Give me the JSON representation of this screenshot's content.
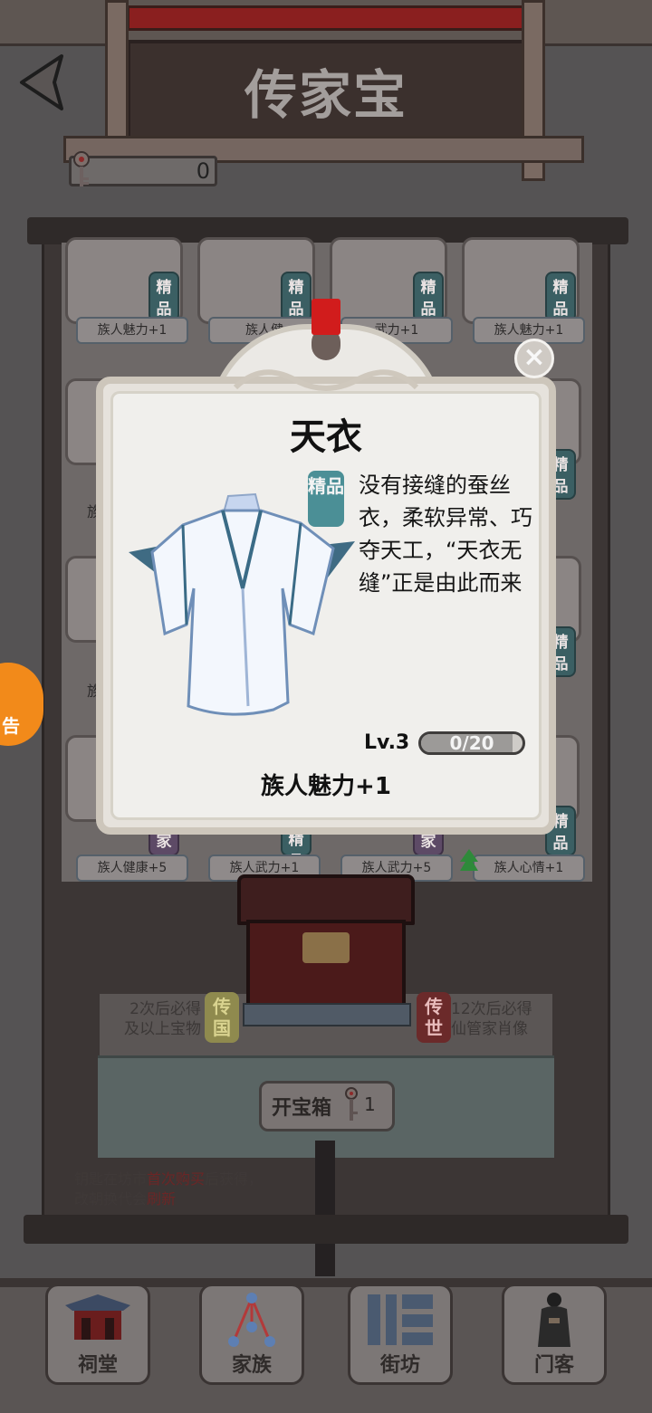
{
  "header": {
    "title": "传家宝",
    "key_count": "0"
  },
  "grid": {
    "top_row": [
      {
        "label": "族人魅力+1",
        "tag": "精品"
      },
      {
        "label": "族人健",
        "tag": "精品"
      },
      {
        "label": "武力+1",
        "tag": "精品"
      },
      {
        "label": "族人魅力+1",
        "tag": "精品"
      }
    ],
    "bottom_row": [
      {
        "label": "族人健康+5",
        "tag": "家"
      },
      {
        "label": "族人武力+1",
        "tag": "精品"
      },
      {
        "label": "族人武力+5",
        "tag": "家"
      },
      {
        "label": "族人心情+1",
        "tag": "精品"
      }
    ],
    "side_fragments": [
      "族",
      "族",
      "族"
    ],
    "right_tags": [
      "精品",
      "精品",
      "精品"
    ]
  },
  "chest": {
    "left_guarantee": "2次后必得\n及以上宝物",
    "left_badge": "传国",
    "right_guarantee": "12次后必得\n仙管家肖像",
    "right_badge": "传世",
    "open_label": "开宝箱",
    "open_count": "1",
    "hint_prefix": "钥匙在坊市",
    "hint_red1": "首次购买",
    "hint_mid": "后获得，",
    "hint_line2": "改朝换代会",
    "hint_red2": "刷新"
  },
  "side_ad": {
    "label": "告"
  },
  "nav": {
    "items": [
      {
        "label": "祠堂",
        "icon": "shrine-icon"
      },
      {
        "label": "家族",
        "icon": "family-tree-icon"
      },
      {
        "label": "街坊",
        "icon": "street-icon"
      },
      {
        "label": "门客",
        "icon": "retainer-icon"
      }
    ]
  },
  "modal": {
    "name": "天衣",
    "quality_tag": "精品",
    "description": "没有接缝的蚕丝衣，柔软异常、巧夺天工，“天衣无缝”正是由此而来",
    "level": "Lv.3",
    "progress_text": "0/20",
    "progress_fraction": 0,
    "effect": "族人魅力+1"
  },
  "colors": {
    "accent_red": "#d11c1c",
    "quality_teal": "#4b8f96",
    "ad_orange": "#f28a1a"
  }
}
